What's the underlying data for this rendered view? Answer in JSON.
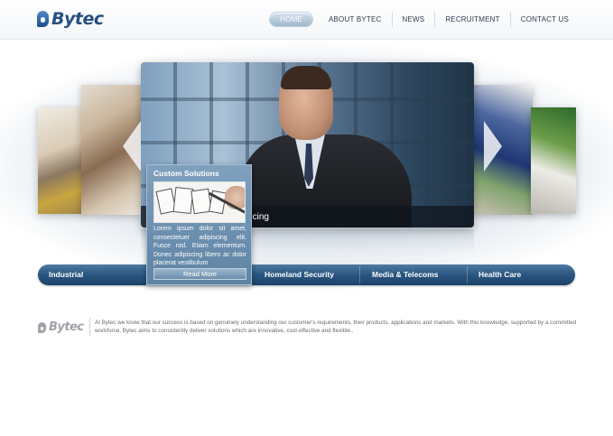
{
  "logo": {
    "text": "Bytec"
  },
  "nav": {
    "items": [
      {
        "label": "HOME"
      },
      {
        "label": "ABOUT BYTEC"
      },
      {
        "label": "NEWS"
      },
      {
        "label": "RECRUITMENT"
      },
      {
        "label": "CONTACT US"
      }
    ],
    "active_index": 0
  },
  "hero": {
    "caption": "cing"
  },
  "popup": {
    "title": "Custom Solutions",
    "text": "Lorem ipsum dolor sit amet, consectetuer adipiscing elit. Fusce nisl. Etiam elementum. Donec adipiscing libero ac dolor placerat vestibulum",
    "button_label": "Read More"
  },
  "categories": [
    {
      "label": "Industrial"
    },
    {
      "label": "Homeland Security"
    },
    {
      "label": "Media & Telecoms"
    },
    {
      "label": "Health Care"
    }
  ],
  "footer": {
    "logo_text": "Bytec",
    "text": "At Bytec we know that our success is based on genuinely understanding our customer's requirements, their products, applications and markets.  With this knowledge, supported by a committed workforce, Bytec aims to consistently deliver solutions which are innovative, cost-effective and flexible.."
  },
  "colors": {
    "brand": "#244f83",
    "category_bar": "#2a5680",
    "popup": "#6b8dab"
  }
}
